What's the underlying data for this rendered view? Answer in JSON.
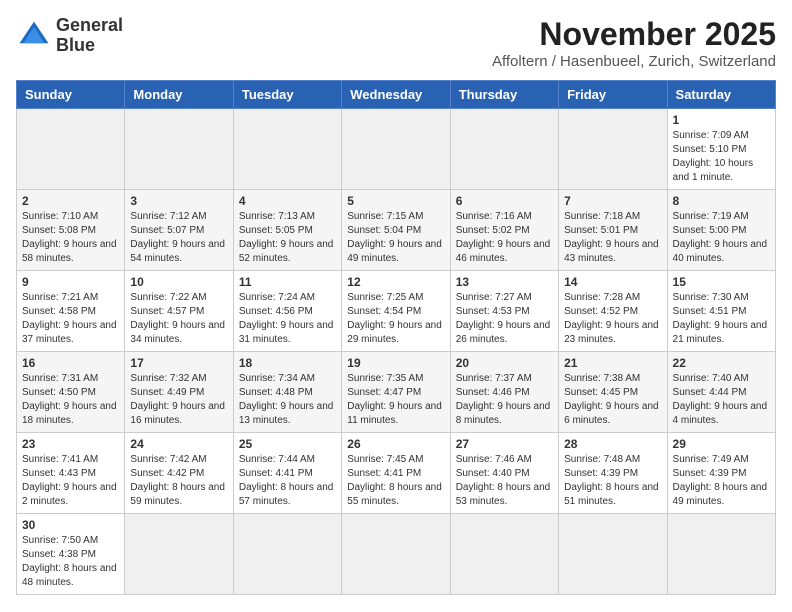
{
  "logo": {
    "line1": "General",
    "line2": "Blue"
  },
  "header": {
    "month": "November 2025",
    "location": "Affoltern / Hasenbueel, Zurich, Switzerland"
  },
  "weekdays": [
    "Sunday",
    "Monday",
    "Tuesday",
    "Wednesday",
    "Thursday",
    "Friday",
    "Saturday"
  ],
  "weeks": [
    [
      {
        "day": "",
        "info": ""
      },
      {
        "day": "",
        "info": ""
      },
      {
        "day": "",
        "info": ""
      },
      {
        "day": "",
        "info": ""
      },
      {
        "day": "",
        "info": ""
      },
      {
        "day": "",
        "info": ""
      },
      {
        "day": "1",
        "info": "Sunrise: 7:09 AM\nSunset: 5:10 PM\nDaylight: 10 hours\nand 1 minute."
      }
    ],
    [
      {
        "day": "2",
        "info": "Sunrise: 7:10 AM\nSunset: 5:08 PM\nDaylight: 9 hours\nand 58 minutes."
      },
      {
        "day": "3",
        "info": "Sunrise: 7:12 AM\nSunset: 5:07 PM\nDaylight: 9 hours\nand 54 minutes."
      },
      {
        "day": "4",
        "info": "Sunrise: 7:13 AM\nSunset: 5:05 PM\nDaylight: 9 hours\nand 52 minutes."
      },
      {
        "day": "5",
        "info": "Sunrise: 7:15 AM\nSunset: 5:04 PM\nDaylight: 9 hours\nand 49 minutes."
      },
      {
        "day": "6",
        "info": "Sunrise: 7:16 AM\nSunset: 5:02 PM\nDaylight: 9 hours\nand 46 minutes."
      },
      {
        "day": "7",
        "info": "Sunrise: 7:18 AM\nSunset: 5:01 PM\nDaylight: 9 hours\nand 43 minutes."
      },
      {
        "day": "8",
        "info": "Sunrise: 7:19 AM\nSunset: 5:00 PM\nDaylight: 9 hours\nand 40 minutes."
      }
    ],
    [
      {
        "day": "9",
        "info": "Sunrise: 7:21 AM\nSunset: 4:58 PM\nDaylight: 9 hours\nand 37 minutes."
      },
      {
        "day": "10",
        "info": "Sunrise: 7:22 AM\nSunset: 4:57 PM\nDaylight: 9 hours\nand 34 minutes."
      },
      {
        "day": "11",
        "info": "Sunrise: 7:24 AM\nSunset: 4:56 PM\nDaylight: 9 hours\nand 31 minutes."
      },
      {
        "day": "12",
        "info": "Sunrise: 7:25 AM\nSunset: 4:54 PM\nDaylight: 9 hours\nand 29 minutes."
      },
      {
        "day": "13",
        "info": "Sunrise: 7:27 AM\nSunset: 4:53 PM\nDaylight: 9 hours\nand 26 minutes."
      },
      {
        "day": "14",
        "info": "Sunrise: 7:28 AM\nSunset: 4:52 PM\nDaylight: 9 hours\nand 23 minutes."
      },
      {
        "day": "15",
        "info": "Sunrise: 7:30 AM\nSunset: 4:51 PM\nDaylight: 9 hours\nand 21 minutes."
      }
    ],
    [
      {
        "day": "16",
        "info": "Sunrise: 7:31 AM\nSunset: 4:50 PM\nDaylight: 9 hours\nand 18 minutes."
      },
      {
        "day": "17",
        "info": "Sunrise: 7:32 AM\nSunset: 4:49 PM\nDaylight: 9 hours\nand 16 minutes."
      },
      {
        "day": "18",
        "info": "Sunrise: 7:34 AM\nSunset: 4:48 PM\nDaylight: 9 hours\nand 13 minutes."
      },
      {
        "day": "19",
        "info": "Sunrise: 7:35 AM\nSunset: 4:47 PM\nDaylight: 9 hours\nand 11 minutes."
      },
      {
        "day": "20",
        "info": "Sunrise: 7:37 AM\nSunset: 4:46 PM\nDaylight: 9 hours\nand 8 minutes."
      },
      {
        "day": "21",
        "info": "Sunrise: 7:38 AM\nSunset: 4:45 PM\nDaylight: 9 hours\nand 6 minutes."
      },
      {
        "day": "22",
        "info": "Sunrise: 7:40 AM\nSunset: 4:44 PM\nDaylight: 9 hours\nand 4 minutes."
      }
    ],
    [
      {
        "day": "23",
        "info": "Sunrise: 7:41 AM\nSunset: 4:43 PM\nDaylight: 9 hours\nand 2 minutes."
      },
      {
        "day": "24",
        "info": "Sunrise: 7:42 AM\nSunset: 4:42 PM\nDaylight: 8 hours\nand 59 minutes."
      },
      {
        "day": "25",
        "info": "Sunrise: 7:44 AM\nSunset: 4:41 PM\nDaylight: 8 hours\nand 57 minutes."
      },
      {
        "day": "26",
        "info": "Sunrise: 7:45 AM\nSunset: 4:41 PM\nDaylight: 8 hours\nand 55 minutes."
      },
      {
        "day": "27",
        "info": "Sunrise: 7:46 AM\nSunset: 4:40 PM\nDaylight: 8 hours\nand 53 minutes."
      },
      {
        "day": "28",
        "info": "Sunrise: 7:48 AM\nSunset: 4:39 PM\nDaylight: 8 hours\nand 51 minutes."
      },
      {
        "day": "29",
        "info": "Sunrise: 7:49 AM\nSunset: 4:39 PM\nDaylight: 8 hours\nand 49 minutes."
      }
    ],
    [
      {
        "day": "30",
        "info": "Sunrise: 7:50 AM\nSunset: 4:38 PM\nDaylight: 8 hours\nand 48 minutes."
      },
      {
        "day": "",
        "info": ""
      },
      {
        "day": "",
        "info": ""
      },
      {
        "day": "",
        "info": ""
      },
      {
        "day": "",
        "info": ""
      },
      {
        "day": "",
        "info": ""
      },
      {
        "day": "",
        "info": ""
      }
    ]
  ]
}
